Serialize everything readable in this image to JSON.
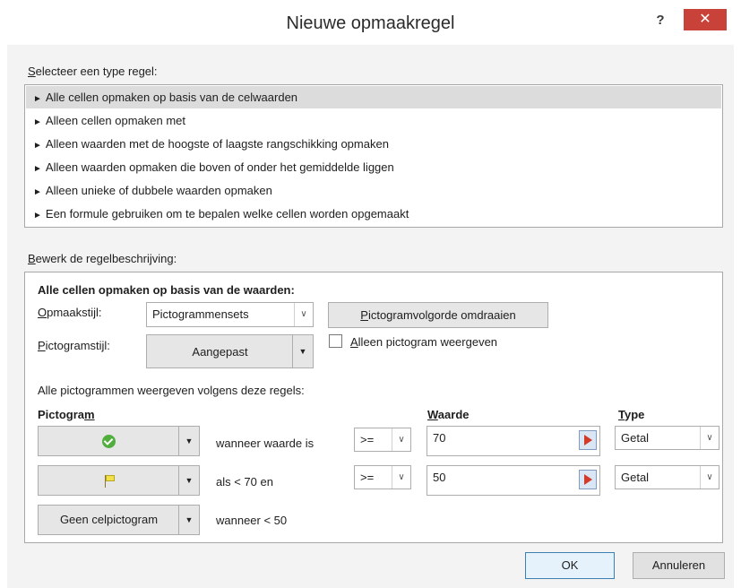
{
  "dialog": {
    "title": "Nieuwe opmaakregel",
    "help_glyph": "?",
    "close_glyph": "✕"
  },
  "rule_type": {
    "label_first": "S",
    "label_rest": "electeer een type regel:",
    "items": [
      "Alle cellen opmaken op basis van de celwaarden",
      "Alleen cellen opmaken met",
      "Alleen waarden met de hoogste of laagste rangschikking opmaken",
      "Alleen waarden opmaken die boven of onder het gemiddelde liggen",
      "Alleen unieke of dubbele waarden opmaken",
      "Een formule gebruiken om te bepalen welke cellen worden opgemaakt"
    ],
    "selected_index": 0,
    "arrow_glyph": "►"
  },
  "edit": {
    "label_first": "B",
    "label_rest": "ewerk de regelbeschrijving:",
    "heading": "Alle cellen opmaken op basis van de waarden:",
    "format_style_label_first": "O",
    "format_style_label_rest": "pmaakstijl:",
    "format_style_value": "Pictogrammensets",
    "reverse_button_first": "P",
    "reverse_button_rest": "ictogramvolgorde omdraaien",
    "icon_style_label_first": "P",
    "icon_style_label_rest": "ictogramstijl:",
    "icon_style_value": "Aangepast",
    "icon_only_first": "A",
    "icon_only_rest": "lleen pictogram weergeven",
    "icon_only_checked": false,
    "rules_intro": "Alle pictogrammen weergeven volgens deze regels:",
    "col_icon_first": "Pictogra",
    "col_icon_u": "m",
    "col_value_u": "W",
    "col_value_rest": "aarde",
    "col_type_u": "T",
    "col_type_rest": "ype",
    "rows": [
      {
        "icon": "green-check-circle-icon",
        "condition": "wanneer waarde is",
        "operator": ">=",
        "value": "70",
        "type": "Getal"
      },
      {
        "icon": "yellow-flag-icon",
        "condition": "als < 70 en",
        "operator": ">=",
        "value": "50",
        "type": "Getal"
      },
      {
        "icon_label": "Geen celpictogram",
        "condition": "wanneer < 50"
      }
    ],
    "dropdown_glyph": "∨",
    "split_glyph": "▼"
  },
  "footer": {
    "ok_label": "OK",
    "cancel_label": "Annuleren"
  },
  "colors": {
    "close_button": "#c9423a",
    "selected_item": "#dcdcdc",
    "dialog_background": "#f3f3f3"
  }
}
